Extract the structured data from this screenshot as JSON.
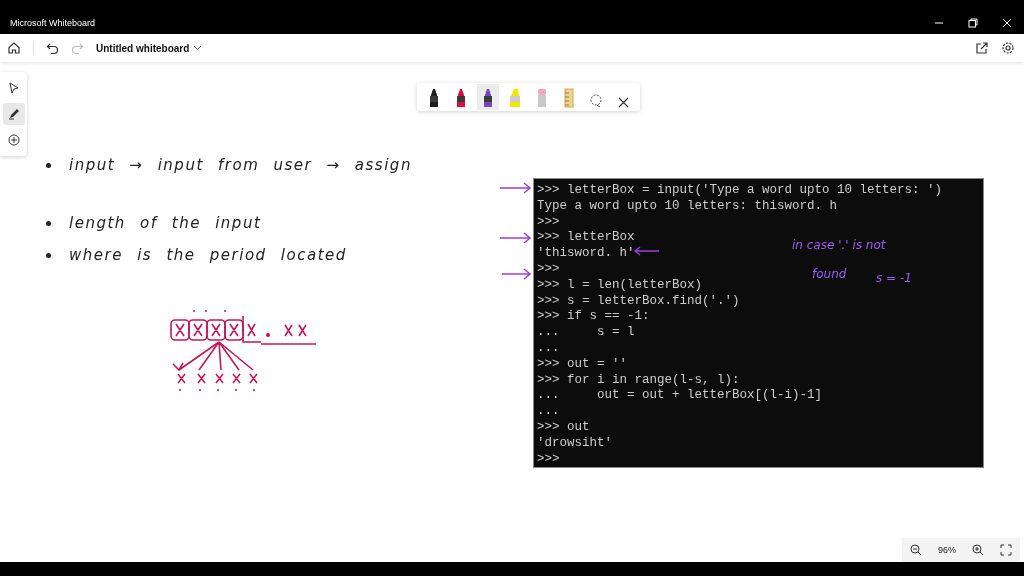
{
  "window": {
    "title": "Microsoft Whiteboard"
  },
  "toolbar": {
    "board_name": "Untitled whiteboard"
  },
  "left_rail": [
    {
      "kind": "pointer",
      "selected": false
    },
    {
      "kind": "pen",
      "selected": true
    },
    {
      "kind": "add",
      "selected": false
    }
  ],
  "pen_tray": [
    {
      "kind": "pen",
      "color": "#1e1e1e",
      "selected": false
    },
    {
      "kind": "pen",
      "color": "#d4123f",
      "selected": false
    },
    {
      "kind": "pen",
      "color": "#7b3fc4",
      "selected": true
    },
    {
      "kind": "highlighter",
      "color": "#f0e800",
      "selected": false
    },
    {
      "kind": "eraser",
      "selected": false
    },
    {
      "kind": "ruler",
      "selected": false
    },
    {
      "kind": "lasso",
      "selected": false
    },
    {
      "kind": "close",
      "selected": false
    }
  ],
  "notes": [
    {
      "text": "input → input from user → assign"
    },
    {
      "text": "length of the input"
    },
    {
      "text": "where is the period located"
    }
  ],
  "console": {
    "lines": [
      ">>> letterBox = input('Type a word upto 10 letters: ')",
      "Type a word upto 10 letters: thisword. h",
      ">>>",
      ">>> letterBox",
      "'thisword. h'",
      ">>>",
      ">>> l = len(letterBox)",
      ">>> s = letterBox.find('.')",
      ">>> if s == -1:",
      "...     s = l",
      "...",
      ">>> out = ''",
      ">>> for i in range(l-s, l):",
      "...     out = out + letterBox[(l-i)-1]",
      "...",
      ">>> out",
      "'drowsiht'",
      ">>>"
    ]
  },
  "console_annotations": [
    {
      "text": "in case '.' is not"
    },
    {
      "text": "found"
    },
    {
      "text": "s = -1"
    }
  ],
  "zoom": {
    "value": "96%"
  }
}
